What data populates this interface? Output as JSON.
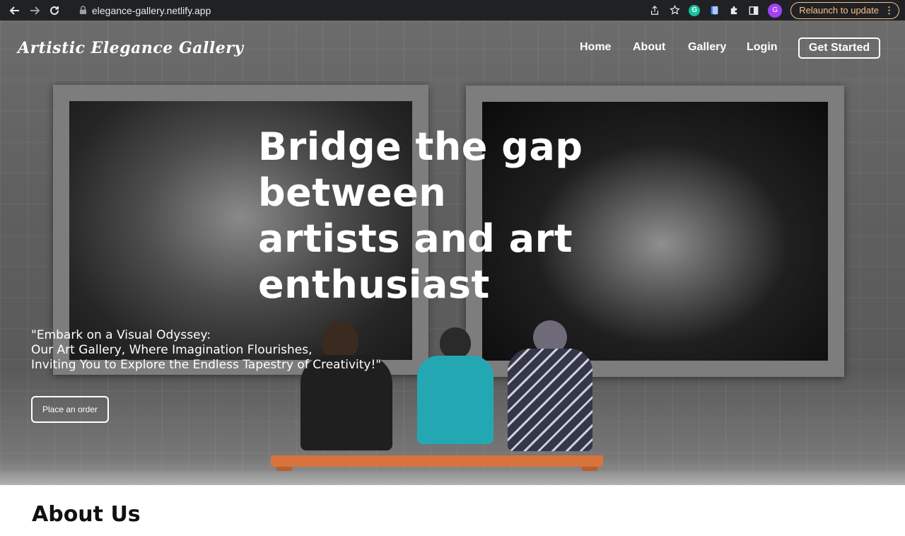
{
  "browser": {
    "url": "elegance-gallery.netlify.app",
    "relaunch_label": "Relaunch to update",
    "profile_initial": "G",
    "grammarly_initial": "G",
    "relaunch_color": "#f6c28b"
  },
  "header": {
    "logo": "Artistic Elegance Gallery",
    "nav": {
      "home": "Home",
      "about": "About",
      "gallery": "Gallery",
      "login": "Login"
    },
    "cta": "Get Started"
  },
  "hero": {
    "headline": "Bridge the gap between artists and art enthusiast",
    "tagline_lines": [
      "\"Embark on a Visual Odyssey:",
      "Our Art Gallery, Where Imagination Flourishes,",
      "Inviting You to Explore the Endless Tapestry of Creativity!\""
    ],
    "order_button": "Place an order"
  },
  "about": {
    "title": "About Us"
  }
}
